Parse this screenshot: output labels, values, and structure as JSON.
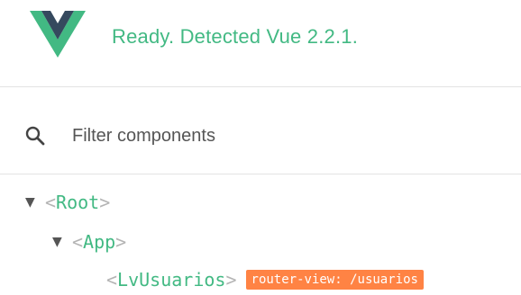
{
  "header": {
    "logo_icon": "vue-logo-icon",
    "status_text": "Ready. Detected Vue 2.2.1.",
    "colors": {
      "vue_green": "#42b983",
      "vue_dark": "#35495e"
    }
  },
  "search": {
    "icon": "search-icon",
    "placeholder": "Filter components",
    "value": ""
  },
  "tree": {
    "nodes": [
      {
        "name": "Root",
        "expanded": true,
        "arrow": "▼"
      },
      {
        "name": "App",
        "expanded": true,
        "arrow": "▼"
      },
      {
        "name": "LvUsuarios",
        "badge": "router-view: /usuarios"
      }
    ],
    "colors": {
      "tag": "#42b983",
      "bracket": "#b4b4b4",
      "badge_bg": "#ff8344"
    }
  }
}
